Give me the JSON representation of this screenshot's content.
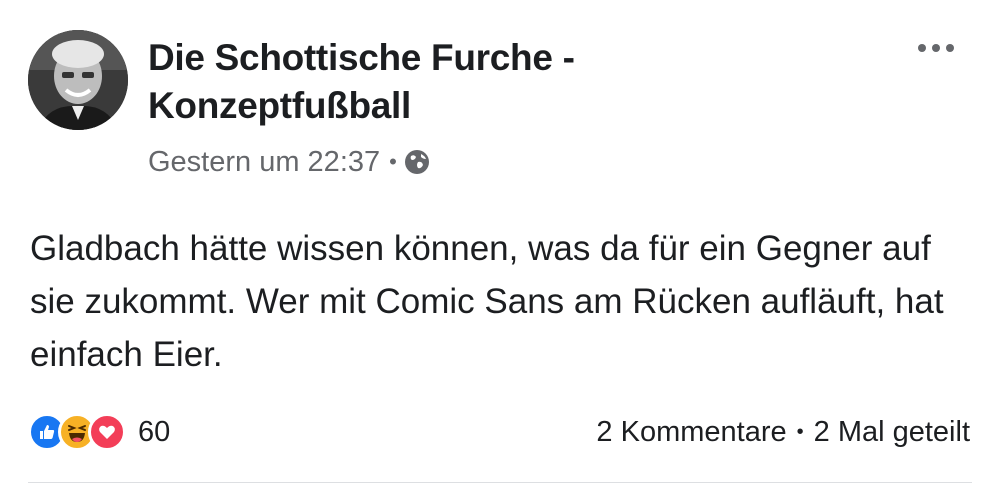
{
  "post": {
    "author": "Die Schottische Furche - Konzeptfußball",
    "timestamp": "Gestern um 22:37",
    "separator": "•",
    "privacy_icon": "globe-icon",
    "text": "Gladbach hätte wissen können, was da für ein Gegner auf sie zukommt. Wer mit Comic Sans am Rücken aufläuft, hat einfach Eier.",
    "more_icon": "more-horizontal-icon"
  },
  "reactions": {
    "icons": [
      "like-icon",
      "haha-icon",
      "love-icon"
    ],
    "count": "60"
  },
  "engagement": {
    "comments": "2 Kommentare",
    "separator": "•",
    "shares": "2 Mal geteilt"
  },
  "colors": {
    "like": "#1877f2",
    "haha": "#f7b125",
    "love": "#f33e58",
    "secondary_text": "#65676b",
    "primary_text": "#1c1e21"
  }
}
